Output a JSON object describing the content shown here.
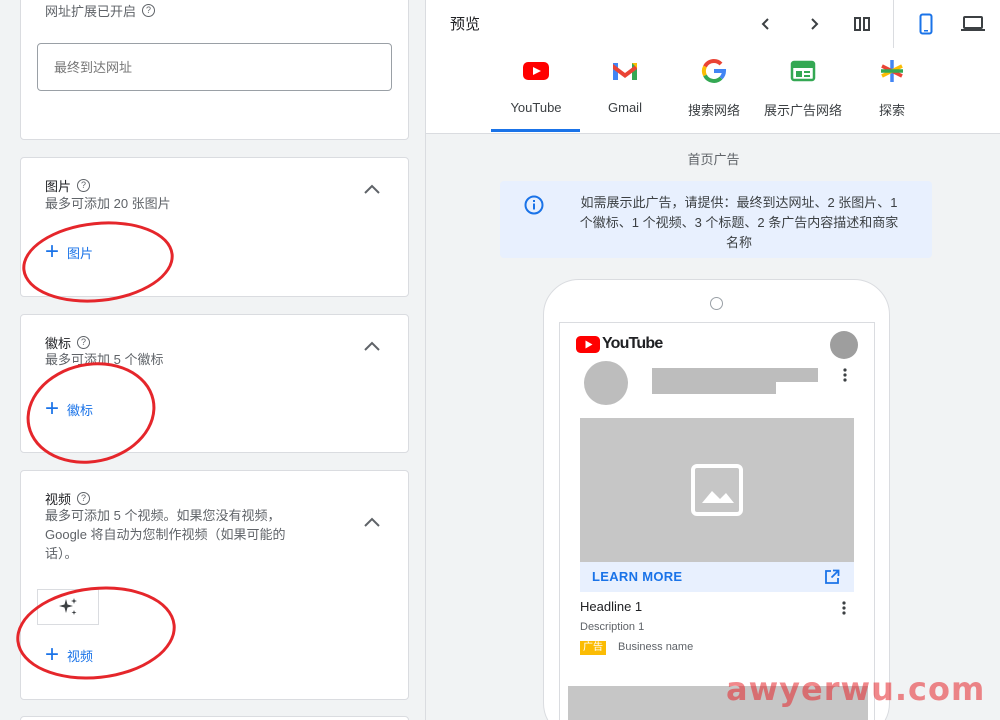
{
  "left": {
    "url_section": {
      "extension_note": "网址扩展已开启",
      "final_url_placeholder": "最终到达网址"
    },
    "images": {
      "title": "图片",
      "subtitle": "最多可添加 20 张图片",
      "add_label": "图片"
    },
    "logos": {
      "title": "徽标",
      "subtitle": "最多可添加 5 个徽标",
      "add_label": "徽标"
    },
    "videos": {
      "title": "视频",
      "subtitle_lines": [
        "最多可添加 5 个视频。如果您没有视频，",
        "Google 将自动为您制作视频（如果可能的",
        "话）。"
      ],
      "add_label": "视频"
    }
  },
  "preview": {
    "title": "预览",
    "tabs": [
      {
        "label": "YouTube",
        "icon": "youtube-icon",
        "active": true
      },
      {
        "label": "Gmail",
        "icon": "gmail-icon"
      },
      {
        "label": "搜索网络",
        "icon": "google-icon"
      },
      {
        "label": "展示广告网络",
        "icon": "display-network-icon"
      },
      {
        "label": "探索",
        "icon": "discover-icon"
      }
    ],
    "section_label": "首页广告",
    "info_text_lines": [
      "如需展示此广告，请提供：最终到达网址、2 张图片、1",
      "个徽标、1 个视频、3 个标题、2 条广告内容描述和商家",
      "名称"
    ],
    "ad": {
      "brand": "YouTube",
      "cta": "LEARN MORE",
      "headline": "Headline 1",
      "description": "Description 1",
      "ad_badge": "广告",
      "business_name": "Business name"
    }
  },
  "watermark": "awyerwu.com",
  "colors": {
    "accent": "#1a73e8",
    "annotation_red": "#e5262b",
    "youtube_red": "#ff0000"
  }
}
